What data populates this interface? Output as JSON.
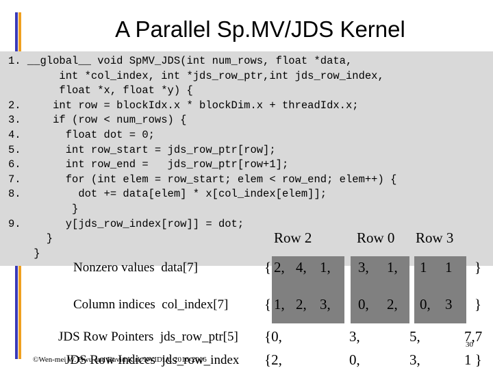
{
  "slide": {
    "title": "A Parallel Sp.MV/JDS Kernel",
    "accent_colors": {
      "blue": "#3a3ab8",
      "orange": "#f0a020",
      "code_bg": "#d9d9d9",
      "highlight": "#808080"
    },
    "code_lines": [
      "1. __global__ void SpMV_JDS(int num_rows, float *data,",
      "        int *col_index, int *jds_row_ptr,int jds_row_index,",
      "        float *x, float *y) {",
      "2.     int row = blockIdx.x * blockDim.x + threadIdx.x;",
      "3.     if (row < num_rows) {",
      "4.       float dot = 0;",
      "5.       int row_start = jds_row_ptr[row];",
      "6.       int row_end =   jds_row_ptr[row+1];",
      "7.       for (int elem = row_start; elem < row_end; elem++) {",
      "8.         dot += data[elem] * x[col_index[elem]];",
      "          }",
      "9.       y[jds_row_index[row]] = dot;",
      "      }",
      "    }"
    ],
    "row_labels": [
      "Row 2",
      "Row 0",
      "Row 3"
    ],
    "data_row": {
      "label": "Nonzero values  data[7]",
      "open": "{",
      "values": [
        "2,",
        "4,",
        "1,",
        "3,",
        "1,",
        "1",
        "1"
      ],
      "close": "}"
    },
    "col_row": {
      "label": "Column indices  col_index[7]",
      "open": "{",
      "values": [
        "1,",
        "2,",
        "3,",
        "0,",
        "2,",
        "0,",
        "3"
      ],
      "close": "}"
    },
    "ptr_row": {
      "label": "JDS Row Pointers  jds_row_ptr[5]",
      "values": [
        "{0,",
        "3,",
        "5,",
        "7,7"
      ]
    },
    "idx_row": {
      "label": "JDS Row Indices  jds_row_index",
      "values": [
        "{2,",
        "0,",
        "3,",
        "1 }"
      ]
    },
    "footer": "©Wen-mei W. Hwu and David Kirk/NVIDIA, 2010-2016",
    "page_number": "30"
  }
}
